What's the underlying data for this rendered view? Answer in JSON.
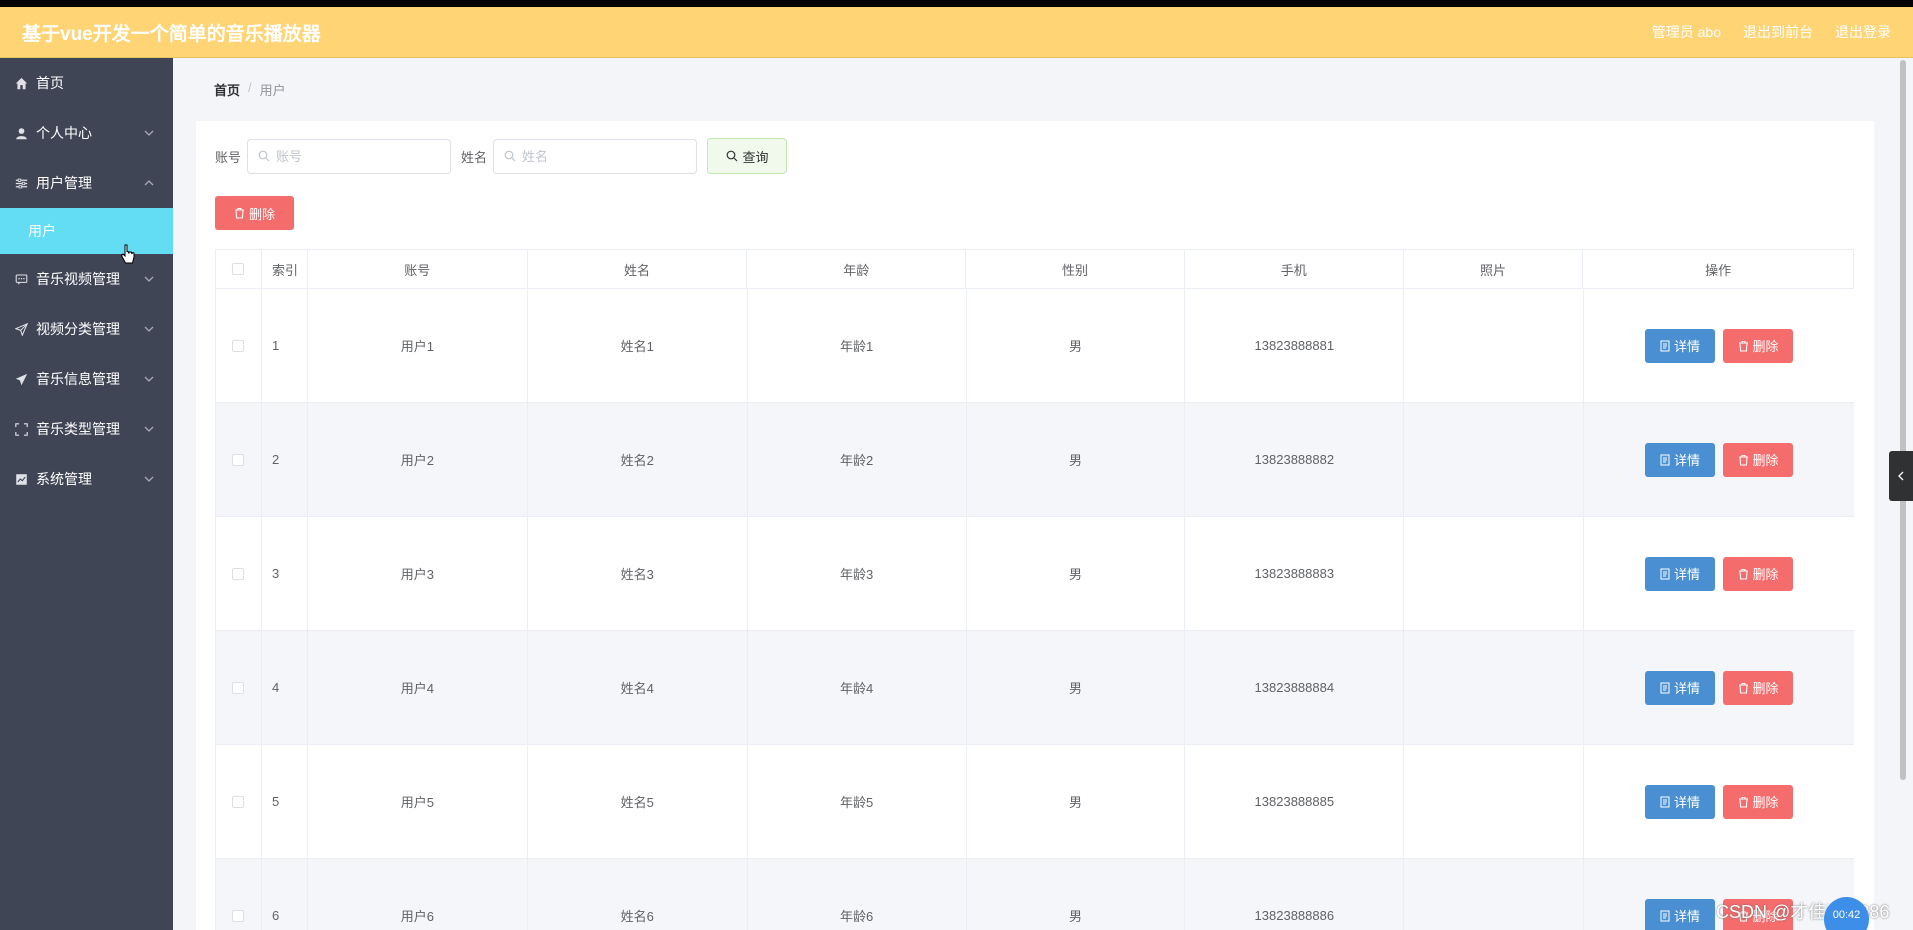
{
  "app": {
    "title": "基于vue开发一个简单的音乐播放器",
    "header_links": [
      "管理员 abo",
      "退出到前台",
      "退出登录"
    ]
  },
  "sidebar": {
    "items": [
      {
        "label": "首页",
        "icon": "home-icon",
        "has_arrow": false
      },
      {
        "label": "个人中心",
        "icon": "user-icon",
        "has_arrow": true
      },
      {
        "label": "用户管理",
        "icon": "sliders-icon",
        "has_arrow": true,
        "expanded": true,
        "children": [
          "用户"
        ]
      },
      {
        "label": "音乐视频管理",
        "icon": "chat-icon",
        "has_arrow": true
      },
      {
        "label": "视频分类管理",
        "icon": "send-icon",
        "has_arrow": true
      },
      {
        "label": "音乐信息管理",
        "icon": "plane-icon",
        "has_arrow": true
      },
      {
        "label": "音乐类型管理",
        "icon": "fullscreen-icon",
        "has_arrow": true
      },
      {
        "label": "系统管理",
        "icon": "chart-icon",
        "has_arrow": true
      }
    ],
    "active_child": "用户"
  },
  "breadcrumb": {
    "home": "首页",
    "sep": "/",
    "current": "用户"
  },
  "search": {
    "account_label": "账号",
    "account_placeholder": "账号",
    "name_label": "姓名",
    "name_placeholder": "姓名",
    "query_label": "查询"
  },
  "toolbar": {
    "delete_label": "删除"
  },
  "table": {
    "headers": [
      "",
      "索引",
      "账号",
      "姓名",
      "年龄",
      "性别",
      "手机",
      "照片",
      "操作"
    ],
    "rows": [
      {
        "index": "1",
        "account": "用户1",
        "name": "姓名1",
        "age": "年龄1",
        "gender": "男",
        "phone": "13823888881",
        "photo": ""
      },
      {
        "index": "2",
        "account": "用户2",
        "name": "姓名2",
        "age": "年龄2",
        "gender": "男",
        "phone": "13823888882",
        "photo": ""
      },
      {
        "index": "3",
        "account": "用户3",
        "name": "姓名3",
        "age": "年龄3",
        "gender": "男",
        "phone": "13823888883",
        "photo": ""
      },
      {
        "index": "4",
        "account": "用户4",
        "name": "姓名4",
        "age": "年龄4",
        "gender": "男",
        "phone": "13823888884",
        "photo": ""
      },
      {
        "index": "5",
        "account": "用户5",
        "name": "姓名5",
        "age": "年龄5",
        "gender": "男",
        "phone": "13823888885",
        "photo": ""
      },
      {
        "index": "6",
        "account": "用户6",
        "name": "姓名6",
        "age": "年龄6",
        "gender": "男",
        "phone": "13823888886",
        "photo": ""
      }
    ],
    "detail_label": "详情",
    "delete_label": "删除"
  },
  "overlay": {
    "watermark": "CSDN @才佳inc8386",
    "timer": "00:42"
  },
  "colors": {
    "header_bg": "#ffd475",
    "sidebar_bg": "#404556",
    "active_submenu": "#62ddf3",
    "danger": "#f56c6c",
    "primary": "#4a8fd1",
    "query_bg": "#f0f9eb"
  }
}
